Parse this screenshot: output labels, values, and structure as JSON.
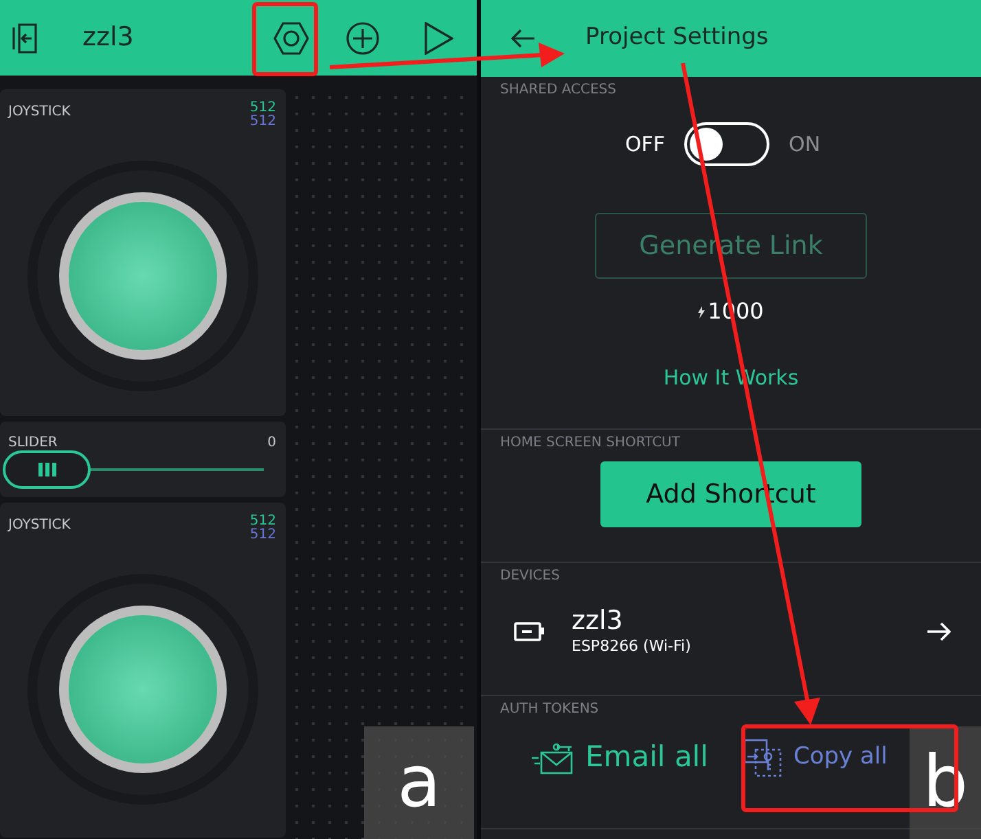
{
  "left_screen": {
    "top_bar": {
      "title": "zzl3"
    },
    "widgets": [
      {
        "kind": "joystick",
        "label": "JOYSTICK",
        "x_value": "512",
        "y_value": "512"
      },
      {
        "kind": "slider",
        "label": "SLIDER",
        "value": "0"
      },
      {
        "kind": "joystick",
        "label": "JOYSTICK",
        "x_value": "512",
        "y_value": "512"
      }
    ]
  },
  "right_screen": {
    "top_bar": {
      "title": "Project Settings"
    },
    "shared_access": {
      "heading": "SHARED ACCESS",
      "off_label": "OFF",
      "on_label": "ON",
      "on": false,
      "generate_button": {
        "label": "Generate Link",
        "disabled": true
      },
      "energy": "1000",
      "link": "How It Works"
    },
    "shortcut": {
      "heading": "HOME SCREEN SHORTCUT",
      "button": "Add Shortcut"
    },
    "devices": {
      "heading": "DEVICES",
      "items": [
        {
          "name": "zzl3",
          "model": "ESP8266 (Wi-Fi)"
        }
      ]
    },
    "auth_tokens": {
      "heading": "AUTH TOKENS",
      "actions": [
        {
          "kind": "email",
          "label": "Email all"
        },
        {
          "kind": "copy",
          "label": "Copy all"
        }
      ]
    }
  },
  "annotations": {
    "labels": [
      "a",
      "b"
    ]
  }
}
